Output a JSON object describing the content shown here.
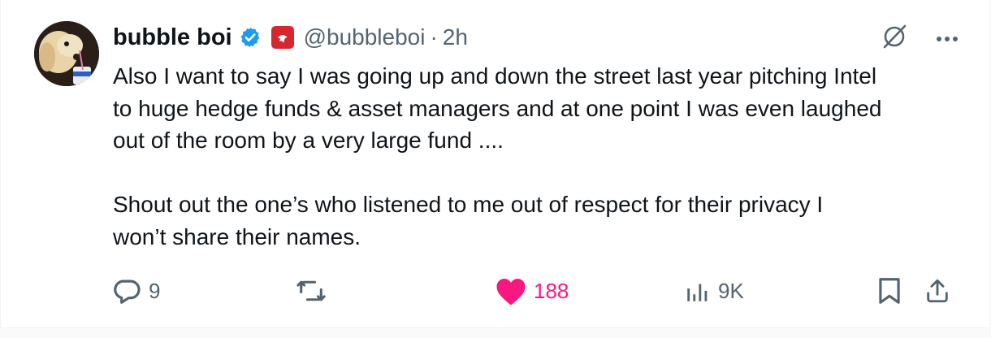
{
  "tweet": {
    "author_name": "bubble boi",
    "handle": "@bubbleboi",
    "separator": "·",
    "time": "2h",
    "text": "Also I want to say I was going up and down the street last year pitching Intel\nto huge hedge funds & asset managers and at one point I was even laughed\nout of the room by a very large fund ....\n\nShout out the one’s who listened to me out of respect for their privacy I\nwon’t share their names."
  },
  "actions": {
    "replies": "9",
    "reposts": "",
    "likes": "188",
    "views": "9K"
  },
  "colors": {
    "text": "#0f1419",
    "muted": "#536471",
    "verified": "#1d9bf0",
    "like": "#f91880",
    "affiliate_badge": "#d8262e"
  },
  "icons": [
    "verified-badge-icon",
    "affiliate-badge-icon",
    "grok-icon",
    "more-icon",
    "reply-icon",
    "repost-icon",
    "like-icon",
    "views-icon",
    "bookmark-icon",
    "share-icon"
  ]
}
